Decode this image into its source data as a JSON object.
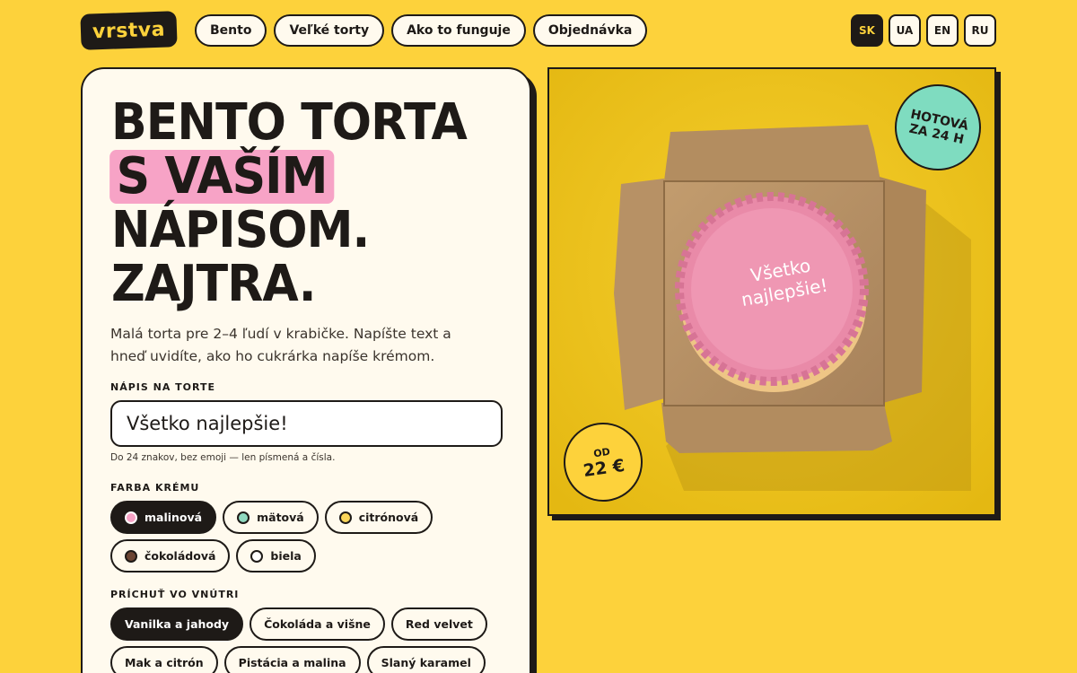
{
  "brand": {
    "logo": "vrstva"
  },
  "nav": {
    "items": [
      {
        "label": "Bento"
      },
      {
        "label": "Veľké torty"
      },
      {
        "label": "Ako to funguje"
      },
      {
        "label": "Objednávka"
      }
    ]
  },
  "languages": {
    "items": [
      {
        "label": "SK",
        "active": true
      },
      {
        "label": "UA"
      },
      {
        "label": "EN"
      },
      {
        "label": "RU"
      }
    ]
  },
  "hero": {
    "line1": "BENTO TORTA",
    "line2": "S VAŠÍM",
    "line3": "NÁPISOM.",
    "line4": "ZAJTRA.",
    "intro": "Malá torta pre 2–4 ľudí v krabičke. Napíšte text a hneď uvidíte, ako ho cukrárka napíše krémom."
  },
  "inscription": {
    "label": "NÁPIS NA TORTE",
    "value": "Všetko najlepšie!",
    "hint": "Do 24 znakov, bez emoji — len písmená a čísla."
  },
  "cream": {
    "label": "FARBA KRÉMU",
    "options": [
      {
        "label": "malinová",
        "color": "#f7a3c6",
        "active": true
      },
      {
        "label": "mätová",
        "color": "#8fd9c0"
      },
      {
        "label": "citrónová",
        "color": "#fbd65a"
      },
      {
        "label": "čokoládová",
        "color": "#6b4433"
      },
      {
        "label": "biela",
        "color": "#ffffff"
      }
    ]
  },
  "flavor": {
    "label": "PRÍCHUŤ VO VNÚTRI",
    "options": [
      {
        "label": "Vanilka a jahody",
        "active": true
      },
      {
        "label": "Čokoláda a višne"
      },
      {
        "label": "Red velvet"
      },
      {
        "label": "Mak a citrón"
      },
      {
        "label": "Pistácia a malina"
      },
      {
        "label": "Slaný karamel"
      }
    ]
  },
  "photo": {
    "cake_text": "Všetko najlepšie!",
    "badge_ready_line1": "HOTOVÁ",
    "badge_ready_line2": "ZA 24 H",
    "badge_price_line1": "OD",
    "badge_price_line2": "22 €"
  },
  "colors": {
    "background": "#fdd23b",
    "ink": "#1e1a17",
    "card": "#fffaee",
    "highlight": "#f7a3c6",
    "mint": "#7fdcc0"
  }
}
